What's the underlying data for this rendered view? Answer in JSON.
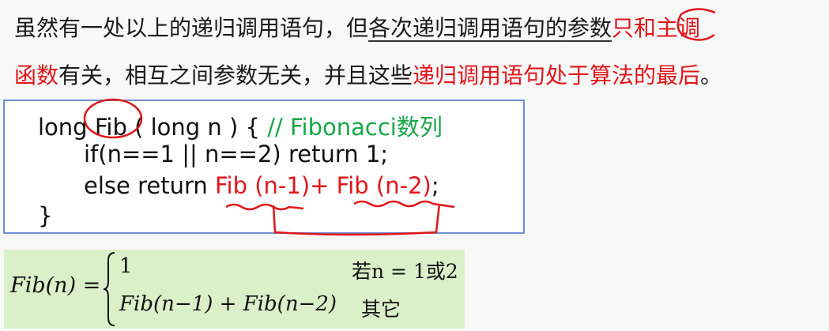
{
  "paragraph": {
    "l1_a": "虽然有一处以上的递归调用语句，但",
    "l1_b": "各次递归调用语句的",
    "l1_c": "参数",
    "l1_d": "只和主调",
    "l2_a": "函数",
    "l2_b": "有关，相互之间参数无关，并且这些",
    "l2_c": "递归调用语句处于算法的最后",
    "l2_d": "。"
  },
  "code": {
    "l1_a": "long ",
    "l1_fn": "Fib",
    "l1_b": " ( long n ) {   ",
    "l1_comment": "// Fibonacci数列",
    "l2": "if(n==1 || n==2) return 1;",
    "l3_a": "else return ",
    "l3_b": "Fib (n-1)+ Fib (n-2)",
    "l3_c": ";",
    "l4": "}"
  },
  "formula": {
    "lhs": "Fib(n) =",
    "case1": "1",
    "case2": "Fib(n−1) + Fib(n−2)",
    "cond1": "若n = 1或2",
    "cond2": "其它"
  },
  "colors": {
    "red": "#e0161a",
    "green": "#19a64a",
    "box_border": "#6d8ed0",
    "formula_bg": "#d9f0c8"
  }
}
